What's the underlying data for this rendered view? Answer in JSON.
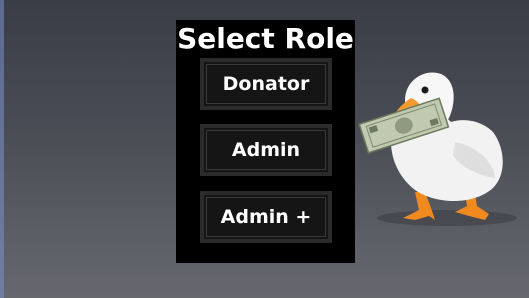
{
  "dialog": {
    "title": "Select Role",
    "buttons": [
      {
        "label": "Donator"
      },
      {
        "label": "Admin"
      },
      {
        "label": "Admin +"
      }
    ]
  },
  "mascot": {
    "icon": "duck-with-money-icon"
  },
  "colors": {
    "panel_bg": "#000000",
    "button_bg": "#151515",
    "button_border": "#2b2b2b",
    "text": "#ffffff"
  }
}
